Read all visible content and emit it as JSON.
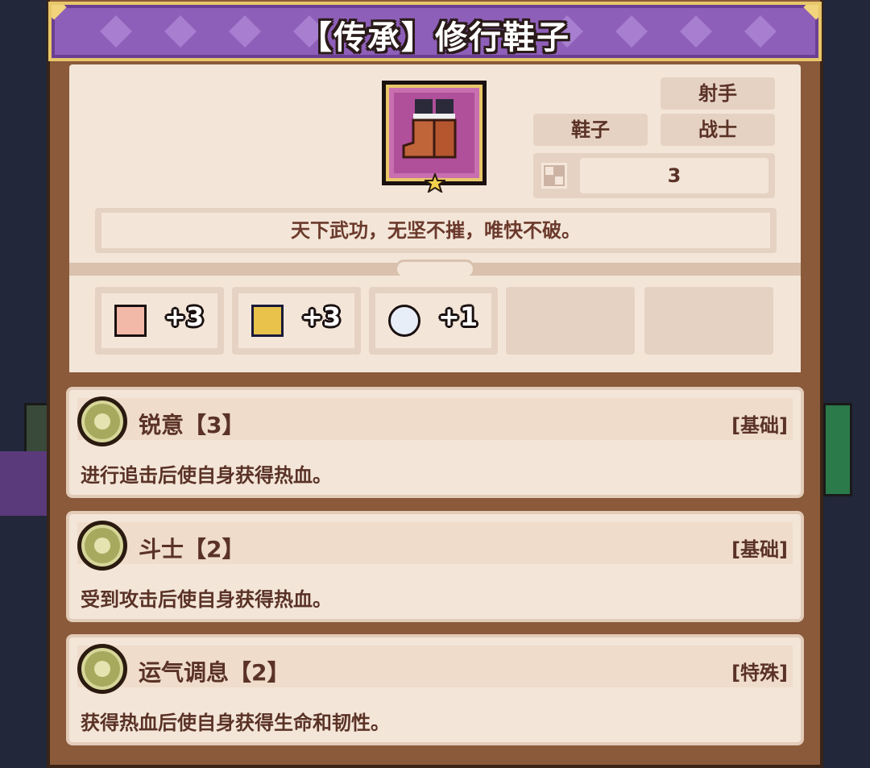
{
  "header": {
    "title": "【传承】修行鞋子"
  },
  "item": {
    "icon": "boots-icon",
    "rarity_icon": "star-icon",
    "tags": {
      "class1": "射手",
      "type": "鞋子",
      "class2": "战士"
    },
    "stack": {
      "icon": "grid-icon",
      "value": "3"
    },
    "flavor": "天下武功，无坚不摧，唯快不破。"
  },
  "stats": [
    {
      "icon": "fist-icon",
      "value": "+3"
    },
    {
      "icon": "boot-icon",
      "value": "+3"
    },
    {
      "icon": "feather-icon",
      "value": "+1"
    }
  ],
  "skills": [
    {
      "name": "锐意【3】",
      "type": "[基础]",
      "desc": "进行追击后使自身获得热血。",
      "icon": "medal-icon"
    },
    {
      "name": "斗士【2】",
      "type": "[基础]",
      "desc": "受到攻击后使自身获得热血。",
      "icon": "medal-icon"
    },
    {
      "name": "运气调息【2】",
      "type": "[特殊]",
      "desc": "获得热血后使自身获得生命和韧性。",
      "icon": "medal-icon"
    }
  ],
  "colors": {
    "title_bar": "#8e5fb8",
    "panel": "#f3e6d8",
    "tag": "#e6d2c2",
    "text": "#5a3226"
  }
}
